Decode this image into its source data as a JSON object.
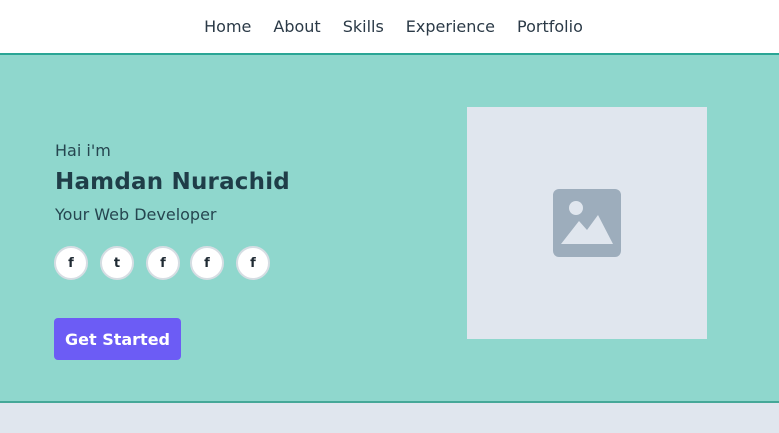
{
  "nav": {
    "items": [
      {
        "label": "Home"
      },
      {
        "label": "About"
      },
      {
        "label": "Skills"
      },
      {
        "label": "Experience"
      },
      {
        "label": "Portfolio"
      }
    ]
  },
  "hero": {
    "greeting": "Hai i'm",
    "name": "Hamdan Nurachid",
    "role": "Your Web Developer",
    "socials": [
      {
        "glyph": "f",
        "icon": "facebook-icon"
      },
      {
        "glyph": "t",
        "icon": "twitter-icon"
      },
      {
        "glyph": "f",
        "icon": "facebook-icon"
      },
      {
        "glyph": "f",
        "icon": "facebook-icon"
      },
      {
        "glyph": "f",
        "icon": "facebook-icon"
      }
    ],
    "cta_label": "Get Started",
    "image_icon": "image-placeholder-icon"
  },
  "colors": {
    "hero_bg": "#8fd7cd",
    "accent": "#6c5cf5",
    "nav_border": "#2aa595",
    "placeholder_bg": "#e0e6ee",
    "placeholder_icon": "#9dadbc"
  }
}
